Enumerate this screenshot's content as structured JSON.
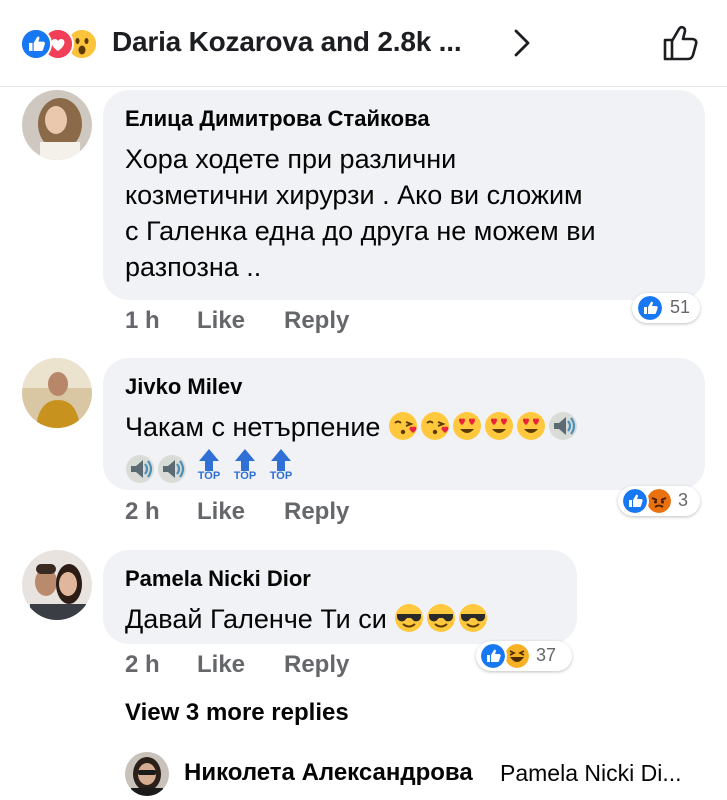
{
  "header": {
    "title": "Daria Kozarova and 2.8k ...",
    "reactions": [
      "like-icon",
      "love-icon",
      "wow-icon"
    ],
    "chevron_icon": "chevron-right-icon",
    "like_button_icon": "thumbs-up-icon"
  },
  "comments": [
    {
      "author": "Елица Димитрова Стайкова",
      "lines": [
        "Хора ходете при различни",
        "козметични хирурзи . Ако ви сложим",
        "с Галенка една до друга не можем ви",
        "разпозна .."
      ],
      "time": "1 h",
      "like_label": "Like",
      "reply_label": "Reply",
      "reaction_count": "51",
      "reactions": [
        "like-icon"
      ]
    },
    {
      "author": "Jivko Milev",
      "text": "Чакам с нетърпение",
      "emojis_line1": [
        "kissing-heart-emoji",
        "kissing-heart-emoji",
        "heart-eyes-emoji",
        "heart-eyes-emoji",
        "heart-eyes-emoji",
        "speaker-emoji"
      ],
      "emojis_line2": [
        "speaker-emoji",
        "speaker-emoji",
        "top-arrow-emoji",
        "top-arrow-emoji",
        "top-arrow-emoji"
      ],
      "top_label": "TOP",
      "time": "2 h",
      "like_label": "Like",
      "reply_label": "Reply",
      "reaction_count": "3",
      "reactions": [
        "like-icon",
        "angry-icon"
      ]
    },
    {
      "author": "Pamela Nicki Dior",
      "text": "Давай Галенче Ти си",
      "emojis": [
        "sunglasses-emoji",
        "sunglasses-emoji",
        "sunglasses-emoji"
      ],
      "time": "2 h",
      "like_label": "Like",
      "reply_label": "Reply",
      "reaction_count": "37",
      "reactions": [
        "like-icon",
        "laughing-icon"
      ]
    }
  ],
  "view_more": "View 3 more replies",
  "reply_preview": {
    "author": "Николета Александрова",
    "text": "Pamela Nicki Di..."
  },
  "colors": {
    "like_blue": "#1877f2",
    "love_red": "#f33e58",
    "bubble_grey": "#f0f2f5",
    "meta_grey": "#65676b",
    "emoji_yellow": "#ffc83d"
  }
}
